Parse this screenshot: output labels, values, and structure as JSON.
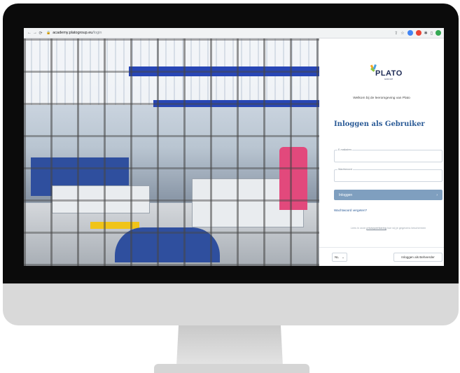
{
  "browser": {
    "back_icon": "arrow-left-icon",
    "forward_icon": "arrow-right-icon",
    "reload_icon": "reload-icon",
    "url_host": "academy.platogroup.eu",
    "url_path": "/login"
  },
  "brand": {
    "logo_text": "PLATO",
    "logo_sub": "GROUP",
    "colors": {
      "primary": "#2a5a96",
      "button": "#7f9fbf",
      "navy": "#1d2a55"
    }
  },
  "login": {
    "welcome": "Welkom bij de leeromgeving van Plato",
    "title": "Inloggen als Gebruiker",
    "email_label": "E-mailadres",
    "email_value": "",
    "password_label": "Wachtwoord",
    "password_value": "",
    "submit_label": "Inloggen",
    "submit_icon": "chevron-right-icon",
    "forgot_label": "Wachtwoord vergeten?",
    "privacy_prefix": "Lees in onze ",
    "privacy_link": "privacyverklaring",
    "privacy_suffix": " hoe wij je gegevens beschermen"
  },
  "footer": {
    "language": "NL",
    "admin_label": "Inloggen als Beheerder"
  }
}
